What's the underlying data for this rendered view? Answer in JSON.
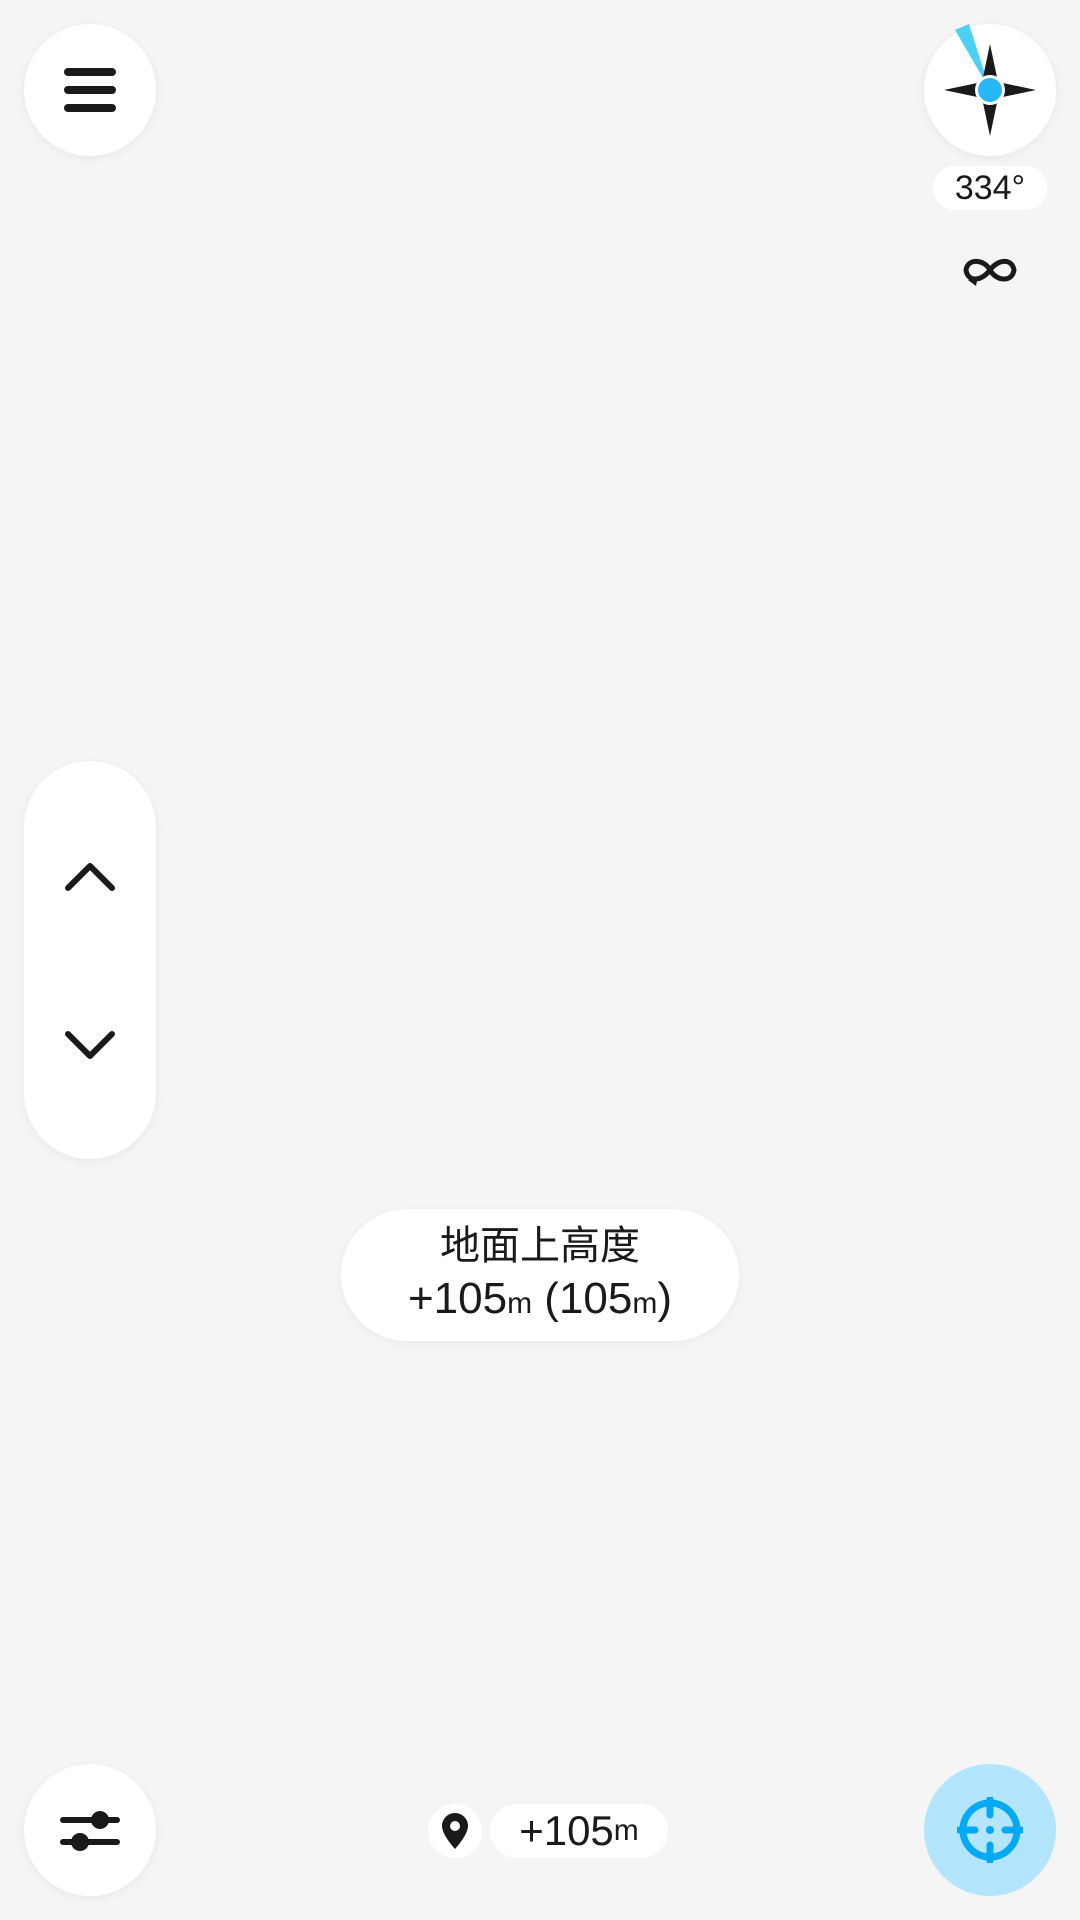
{
  "compass": {
    "heading": "334°",
    "icon": "compass-rose-icon",
    "accent_color": "#29b6f6"
  },
  "altitude_label": {
    "title": "地面上高度",
    "value_prefix": "+105",
    "value_unit": "m",
    "value_paren_open": " (105",
    "value_paren_unit": "m",
    "value_paren_close": ")"
  },
  "bottom_bar": {
    "elevation_value": "+105",
    "elevation_unit": "m"
  },
  "icons": {
    "menu": "hamburger-menu-icon",
    "loop": "infinity-loop-icon",
    "up": "chevron-up-icon",
    "down": "chevron-down-icon",
    "settings": "sliders-icon",
    "pin": "map-pin-icon",
    "locate": "crosshair-icon"
  },
  "colors": {
    "background": "#f5f5f5",
    "button": "#ffffff",
    "locate_button_bg": "#b3e5fc",
    "locate_icon": "#03a9f4",
    "icon": "#1a1a1a"
  }
}
